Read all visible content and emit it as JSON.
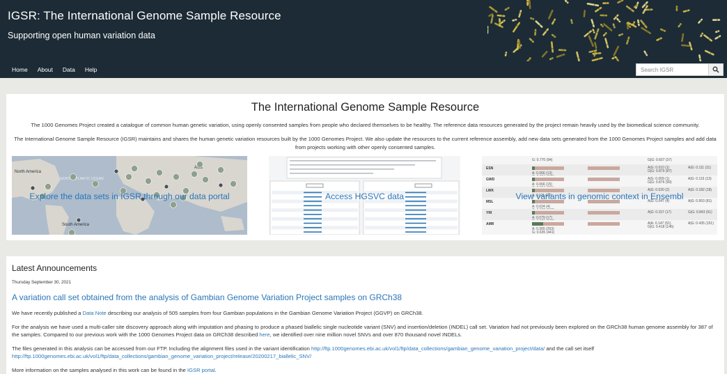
{
  "header": {
    "title": "IGSR: The International Genome Sample Resource",
    "subtitle": "Supporting open human variation data",
    "nav": [
      "Home",
      "About",
      "Data",
      "Help"
    ],
    "search": {
      "placeholder": "Search IGSR"
    },
    "colors": {
      "background": "#1c2b35",
      "text": "#ffffff"
    }
  },
  "intro": {
    "title": "The International Genome Sample Resource",
    "p1": "The 1000 Genomes Project created a catalogue of common human genetic variation, using openly consented samples from people who declared themselves to be healthy. The reference data resources generated by the project remain heavily used by the biomedical science community.",
    "p2": "The International Genome Sample Resource (IGSR) maintains and shares the human genetic variation resources built by the 1000 Genomes Project. We also update the resources to the current reference assembly, add new data sets generated from the 1000 Genomes Project samples and add data from projects working with other openly consented samples.",
    "tiles": [
      {
        "caption": "Explore the data sets in IGSR through our data portal",
        "image": "world-map",
        "map_labels": [
          "North America",
          "NORTH ATLANTIC OCEAN",
          "Asia",
          "South America"
        ]
      },
      {
        "caption": "Access HGSVC data",
        "image": "hgsvc-screenshot"
      },
      {
        "caption": "View variants in genomic context in Ensembl",
        "image": "ensembl-population-table",
        "rows": [
          {
            "pop": "ESN",
            "a": "A: 0.066 (13)",
            "g": "G: 0.934 (185)",
            "ag": "A|G: 0.010 (1)",
            "gg": "G|G: 0.879 (87)",
            "ag2": "A|G: 0.111 (11)"
          },
          {
            "pop": "GWD",
            "a": "A: 0.066 (15)",
            "g": "G: 0.934 (211)",
            "ag": "A|G: 0.009 (1)",
            "gg": "G|G: 0.876 (99)",
            "ag2": "A|G: 0.115 (13)"
          },
          {
            "pop": "LWK",
            "a": "A: 0.111 (22)",
            "g": "",
            "ag": "A|G: 0.020 (2)",
            "gg": "",
            "ag2": "A|G: 0.182 (18)"
          },
          {
            "pop": "MSL",
            "a": "A: 0.024 (4)",
            "g": "G: 0.976 (166)",
            "ag": "A|G: 0.047 (4)",
            "gg": "",
            "ag2": "A|G: 0.953 (81)"
          },
          {
            "pop": "YRI",
            "a": "A: 0.079 (17)",
            "g": "G: 0.921 (199)",
            "ag": "A|G: 0.157 (17)",
            "gg": "",
            "ag2": "G|G: 0.843 (91)"
          },
          {
            "pop": "AMR",
            "a": "A: 0.365 (253)",
            "g": "G: 0.635 (441)",
            "ag": "A|A: 0.147 (51)",
            "gg": "G|G: 0.418 (145)",
            "ag2": "A|G: 0.435 (151)"
          }
        ],
        "top_row": {
          "g": "G: 0.770 (94)",
          "gg": "G|G: 0.607 (37)"
        }
      }
    ]
  },
  "announcements": {
    "heading": "Latest Announcements",
    "date": "Thursday September 30, 2021",
    "title": "A variation call set obtained from the analysis of Gambian Genome Variation Project samples on GRCh38",
    "p1_pre": "We have recently published a ",
    "p1_link": "Data Note",
    "p1_post": " describing our analysis of 505 samples from four Gambian populations in the Gambian Genome Variation Project (GGVP) on GRCh38.",
    "p2": "For the analysis we have used a multi-caller site discovery approach along with imputation and phasing to produce a phased biallelic single nucleotide variant (SNV) and insertion/deletion (INDEL) call set. Variation had not previously been explored on the GRCh38 human genome assembly for 387 of the samples. Compared to our previous work with the 1000 Genomes Project data on GRCh38 described ",
    "p2_link": "here",
    "p2_post": ", we identified over nine million novel SNVs and over 870 thousand novel INDELs.",
    "p3_pre": "The files generated in this analysis can be accessed from our FTP. Including the alignment files used in the variant identification ",
    "p3_link1": "http://ftp.1000genomes.ebi.ac.uk/vol1/ftp/data_collections/gambian_genome_variation_project/data/",
    "p3_mid": " and the call set itself ",
    "p3_link2": "http://ftp.1000genomes.ebi.ac.uk/vol1/ftp/data_collections/gambian_genome_variation_project/release/20200217_biallelic_SNV/",
    "p4_pre": "More information on the samples analysed in this work can be found in the ",
    "p4_link": "IGSR portal",
    "p4_post": ".",
    "colors": {
      "link": "#2a76b8"
    }
  }
}
